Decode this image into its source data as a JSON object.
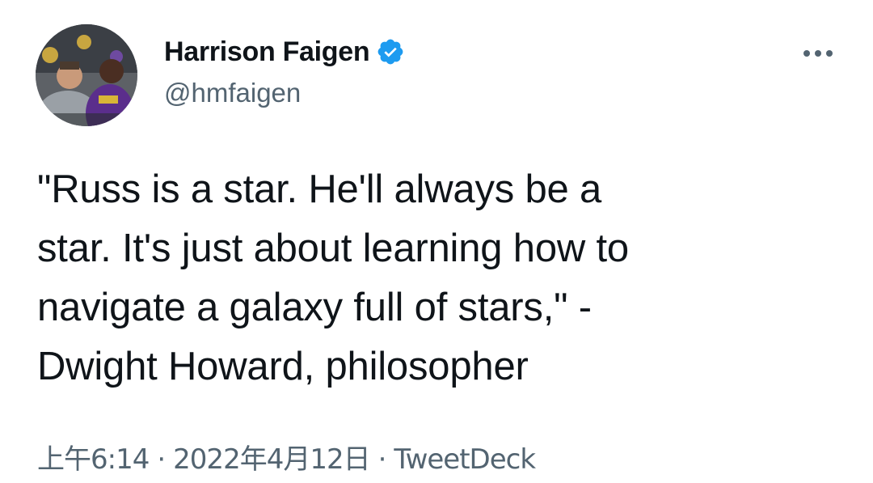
{
  "author": {
    "display_name": "Harrison Faigen",
    "handle": "@hmfaigen",
    "verified": true
  },
  "tweet": {
    "text_lines": [
      "\"Russ is a star. He'll always be a",
      "star. It's just about learning how to",
      "navigate a galaxy full of stars,\" -",
      "Dwight Howard, philosopher"
    ]
  },
  "meta": {
    "time": "上午6:14",
    "separator": "·",
    "date": "2022年4月12日",
    "source": "TweetDeck"
  },
  "colors": {
    "text": "#0f1419",
    "secondary": "#536471",
    "verified_badge": "#1d9bf0"
  },
  "icons": {
    "verified": "verified-badge-icon",
    "more": "more-options-icon"
  }
}
